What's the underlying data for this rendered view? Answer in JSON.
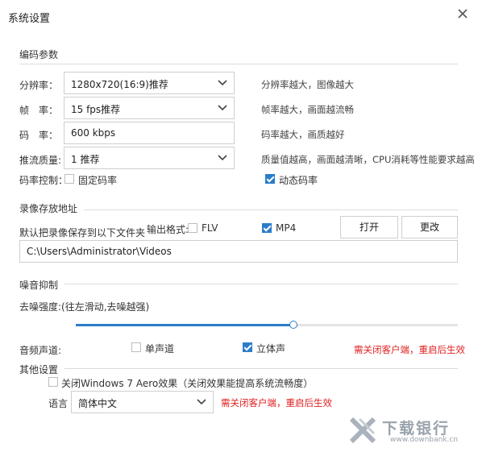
{
  "title": "系统设置",
  "sections": {
    "encode": "编码参数",
    "record": "录像存放地址",
    "noise": "噪音抑制",
    "other": "其他设置"
  },
  "encode": {
    "resolution_label": "分辨率：",
    "resolution_value": "1280x720(16:9)推荐",
    "resolution_desc": "分辨率越大，图像越大",
    "framerate_label": "帧　率：",
    "framerate_value": "15 fps推荐",
    "framerate_desc": "帧率越大，画面越流畅",
    "bitrate_label": "码　率：",
    "bitrate_value": "600 kbps",
    "bitrate_desc": "码率越大，画质越好",
    "quality_label": "推流质量:",
    "quality_value": "1 推荐",
    "quality_desc": "质量值越高，画面越清晰，CPU消耗等性能要求越高",
    "ratecontrol_label": "码率控制：",
    "fixed_label": "固定码率",
    "fixed_checked": false,
    "dynamic_label": "动态码率",
    "dynamic_checked": true
  },
  "record": {
    "default_label": "默认把录像保存到以下文件夹",
    "format_label": "输出格式:",
    "flv_label": "FLV",
    "flv_checked": false,
    "mp4_label": "MP4",
    "mp4_checked": true,
    "open_button": "打开",
    "change_button": "更改",
    "path": "C:\\Users\\Administrator\\Videos"
  },
  "noise": {
    "strength_label": "去噪强度:(往左滑动,去噪越强)",
    "slider_value": 0.57
  },
  "audio": {
    "channel_label": "音频声道:",
    "mono_label": "单声道",
    "mono_checked": false,
    "stereo_label": "立体声",
    "stereo_checked": true,
    "restart_note": "需关闭客户端，重启后生效"
  },
  "other": {
    "aero_label": "关闭Windows 7 Aero效果（关闭效果能提高系统流畅度）",
    "aero_checked": false,
    "language_label": "语言",
    "language_value": "简体中文",
    "restart_note": "需关闭客户端，重启后生效"
  },
  "watermark": {
    "text": "下载银行",
    "url": "www.downbank.cn"
  },
  "colors": {
    "accent": "#2b7dc9",
    "warning": "#e02020"
  }
}
